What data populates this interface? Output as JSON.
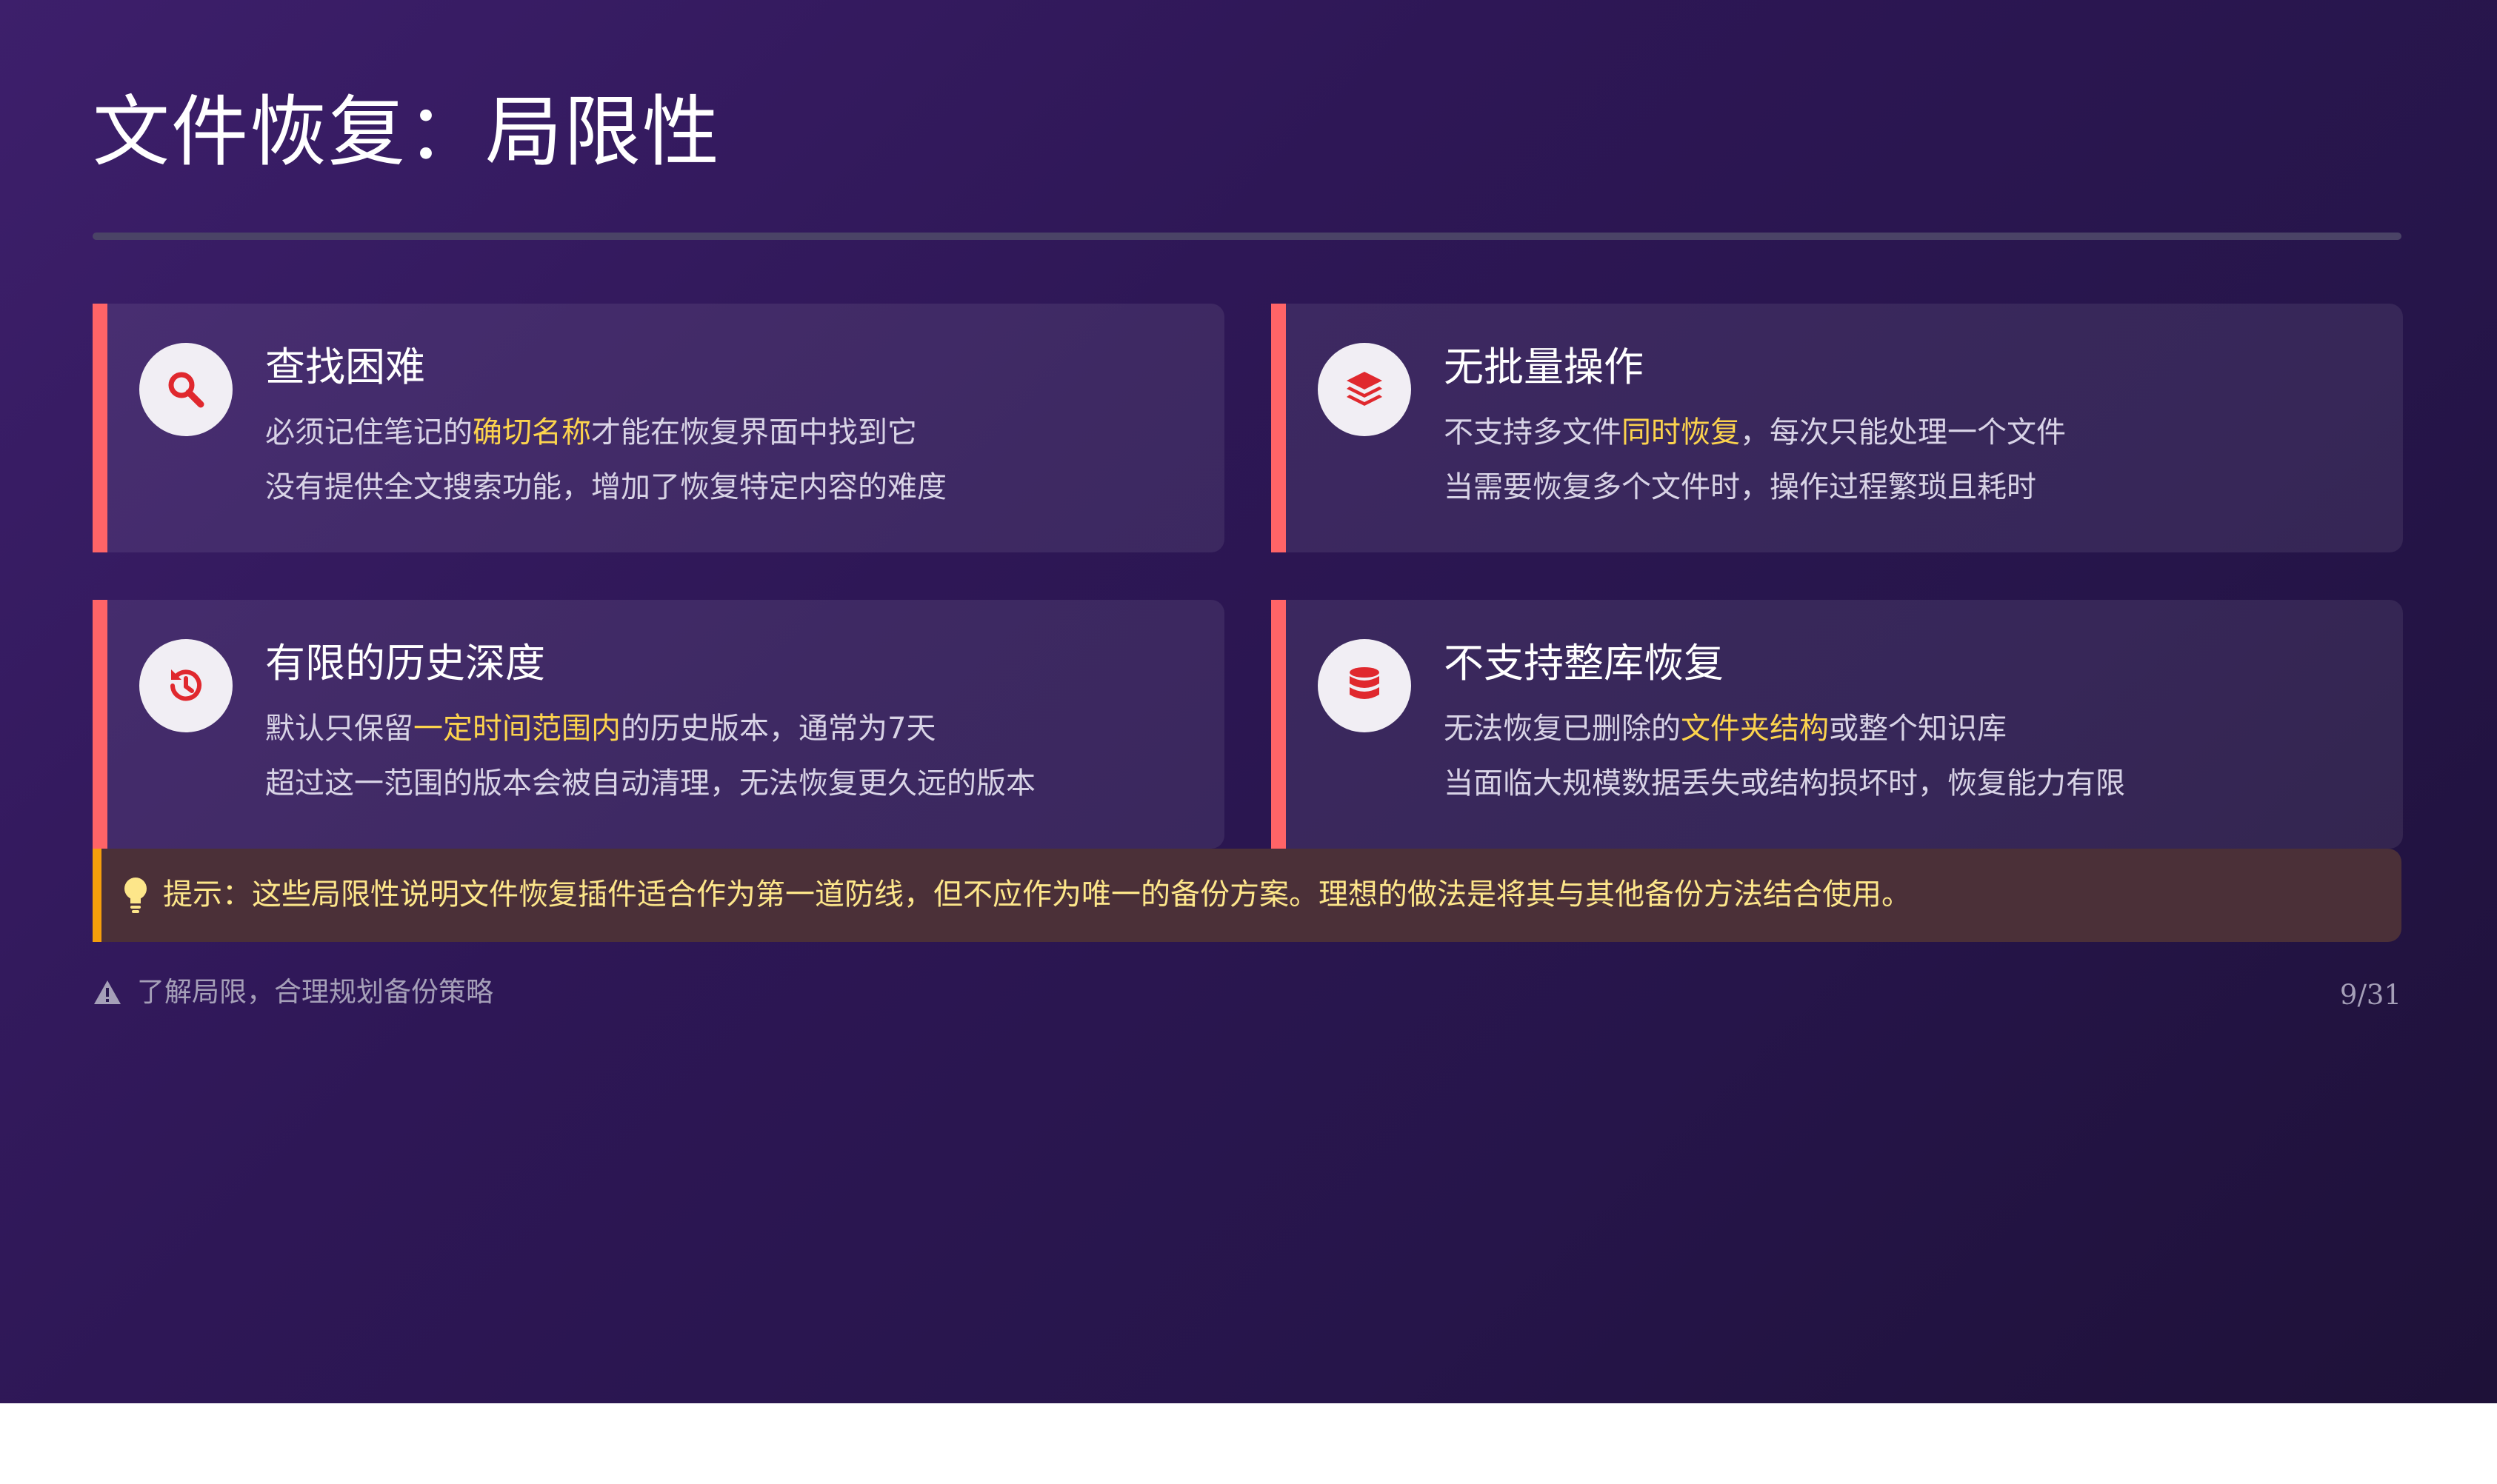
{
  "slide": {
    "title": "文件恢复：局限性",
    "page_number": "9/31"
  },
  "colors": {
    "accent_bar": "#ff6467",
    "icon_red": "#e0282e",
    "highlight": "#fcd34d",
    "tip_bar": "#f59e0b",
    "tip_text": "#fde68a"
  },
  "cards": [
    {
      "icon": "search-icon",
      "title": "查找困难",
      "line1": {
        "pre": "必须记住笔记的",
        "hl": "确切名称",
        "post": "才能在恢复界面中找到它"
      },
      "line2": "没有提供全文搜索功能，增加了恢复特定内容的难度"
    },
    {
      "icon": "layers-icon",
      "title": "无批量操作",
      "line1": {
        "pre": "不支持多文件",
        "hl": "同时恢复",
        "post": "，每次只能处理一个文件"
      },
      "line2": "当需要恢复多个文件时，操作过程繁琐且耗时"
    },
    {
      "icon": "history-icon",
      "title": "有限的历史深度",
      "line1": {
        "pre": "默认只保留",
        "hl": "一定时间范围内",
        "post": "的历史版本，通常为7天"
      },
      "line2": "超过这一范围的版本会被自动清理，无法恢复更久远的版本"
    },
    {
      "icon": "database-icon",
      "title": "不支持整库恢复",
      "line1": {
        "pre": "无法恢复已删除的",
        "hl": "文件夹结构",
        "post": "或整个知识库"
      },
      "line2": "当面临大规模数据丢失或结构损坏时，恢复能力有限"
    }
  ],
  "tip": {
    "icon": "lightbulb-icon",
    "text": "提示：这些局限性说明文件恢复插件适合作为第一道防线，但不应作为唯一的备份方案。理想的做法是将其与其他备份方法结合使用。"
  },
  "footer": {
    "icon": "warning-icon",
    "text": "了解局限，合理规划备份策略"
  }
}
